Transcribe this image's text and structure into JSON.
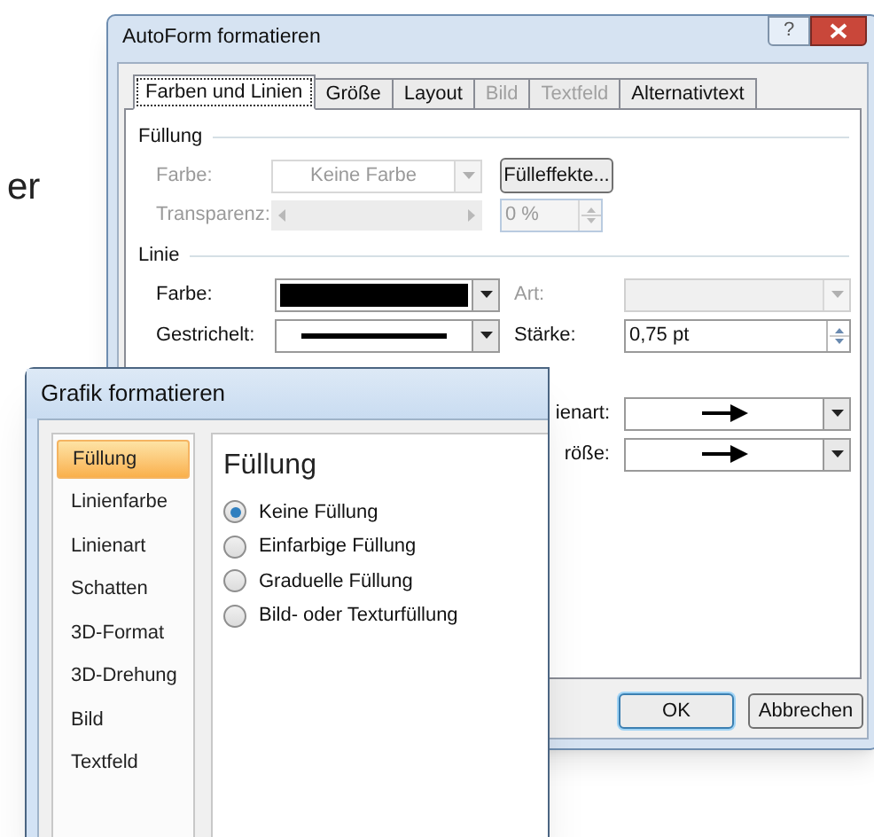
{
  "background_text": "er",
  "back_dialog": {
    "title": "AutoForm formatieren",
    "help_button": "?",
    "tabs": [
      {
        "label": "Farben und Linien",
        "selected": true,
        "disabled": false
      },
      {
        "label": "Größe",
        "selected": false,
        "disabled": false
      },
      {
        "label": "Layout",
        "selected": false,
        "disabled": false
      },
      {
        "label": "Bild",
        "selected": false,
        "disabled": true
      },
      {
        "label": "Textfeld",
        "selected": false,
        "disabled": true
      },
      {
        "label": "Alternativtext",
        "selected": false,
        "disabled": false
      }
    ],
    "fill_section": {
      "heading": "Füllung",
      "disabled": true,
      "color_label": "Farbe:",
      "color_value": "Keine Farbe",
      "effects_button": "Fülleffekte...",
      "transparency_label": "Transparenz:",
      "transparency_value": "0 %"
    },
    "line_section": {
      "heading": "Linie",
      "color_label": "Farbe:",
      "dash_label": "Gestrichelt:",
      "type_label": "Art:",
      "type_disabled": true,
      "weight_label": "Stärke:",
      "weight_value": "0,75 pt"
    },
    "arrow_rows": [
      {
        "label": "ienart:"
      },
      {
        "label": "röße:"
      }
    ],
    "buttons": [
      {
        "label": "OK",
        "default": true
      },
      {
        "label": "Abbrechen",
        "default": false
      }
    ]
  },
  "front_dialog": {
    "title": "Grafik formatieren",
    "categories": [
      {
        "label": "Füllung",
        "selected": true
      },
      {
        "label": "Linienfarbe",
        "selected": false
      },
      {
        "label": "Linienart",
        "selected": false
      },
      {
        "label": "Schatten",
        "selected": false
      },
      {
        "label": "3D-Format",
        "selected": false
      },
      {
        "label": "3D-Drehung",
        "selected": false
      },
      {
        "label": "Bild",
        "selected": false
      },
      {
        "label": "Textfeld",
        "selected": false
      }
    ],
    "heading": "Füllung",
    "options": [
      {
        "label": "Keine Füllung",
        "selected": true
      },
      {
        "label": "Einfarbige Füllung",
        "selected": false
      },
      {
        "label": "Graduelle Füllung",
        "selected": false
      },
      {
        "label": "Bild- oder Texturfüllung",
        "selected": false
      }
    ]
  }
}
